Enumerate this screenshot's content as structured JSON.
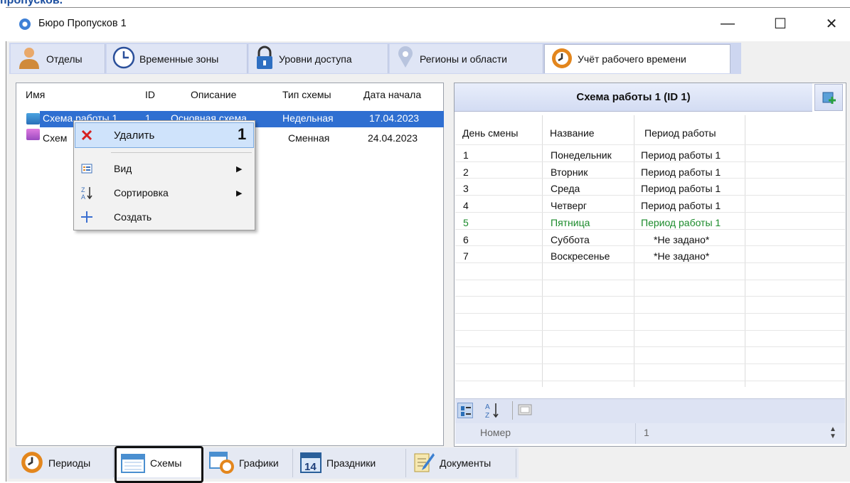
{
  "page_heading_fragment": "пропусков.",
  "window": {
    "title": "Бюро Пропусков 1",
    "min": "—",
    "max": "☐",
    "close": "✕"
  },
  "top_tabs": [
    "Отделы",
    "Временные зоны",
    "Уровни доступа",
    "Регионы и области",
    "Учёт рабочего времени"
  ],
  "list": {
    "headers": [
      "Имя",
      "ID",
      "Описание",
      "Тип схемы",
      "Дата начала"
    ],
    "rows": [
      {
        "name": "Схема работы 1",
        "id": "1",
        "desc": "Основная схема",
        "type": "Недельная",
        "date": "17.04.2023"
      },
      {
        "name": "Схем",
        "id": "",
        "desc": "",
        "type": "Сменная",
        "date": "24.04.2023"
      }
    ]
  },
  "context_menu": {
    "items": [
      "Удалить",
      "Вид",
      "Сортировка",
      "Создать"
    ],
    "callout": "1"
  },
  "scheme_panel": {
    "title": "Схема работы 1 (ID 1)",
    "headers": [
      "День смены",
      "Название",
      "Период работы"
    ],
    "rows": [
      {
        "day": "1",
        "name": "Понедельник",
        "period": "Период работы 1"
      },
      {
        "day": "2",
        "name": "Вторник",
        "period": "Период работы 1"
      },
      {
        "day": "3",
        "name": "Среда",
        "period": "Период работы 1"
      },
      {
        "day": "4",
        "name": "Четверг",
        "period": "Период работы 1"
      },
      {
        "day": "5",
        "name": "Пятница",
        "period": "Период работы 1"
      },
      {
        "day": "6",
        "name": "Суббота",
        "period": "*Не задано*"
      },
      {
        "day": "7",
        "name": "Воскресенье",
        "period": "*Не задано*"
      }
    ],
    "highlight_color": "#1a8a2a"
  },
  "property": {
    "label": "Номер",
    "value": "1"
  },
  "bottom_tabs": [
    "Периоды",
    "Схемы",
    "Графики",
    "Праздники",
    "Документы"
  ],
  "colors": {
    "selection": "#2f6fd1",
    "tab_strip": "#cdd6f0",
    "delete_x": "#d62020"
  }
}
